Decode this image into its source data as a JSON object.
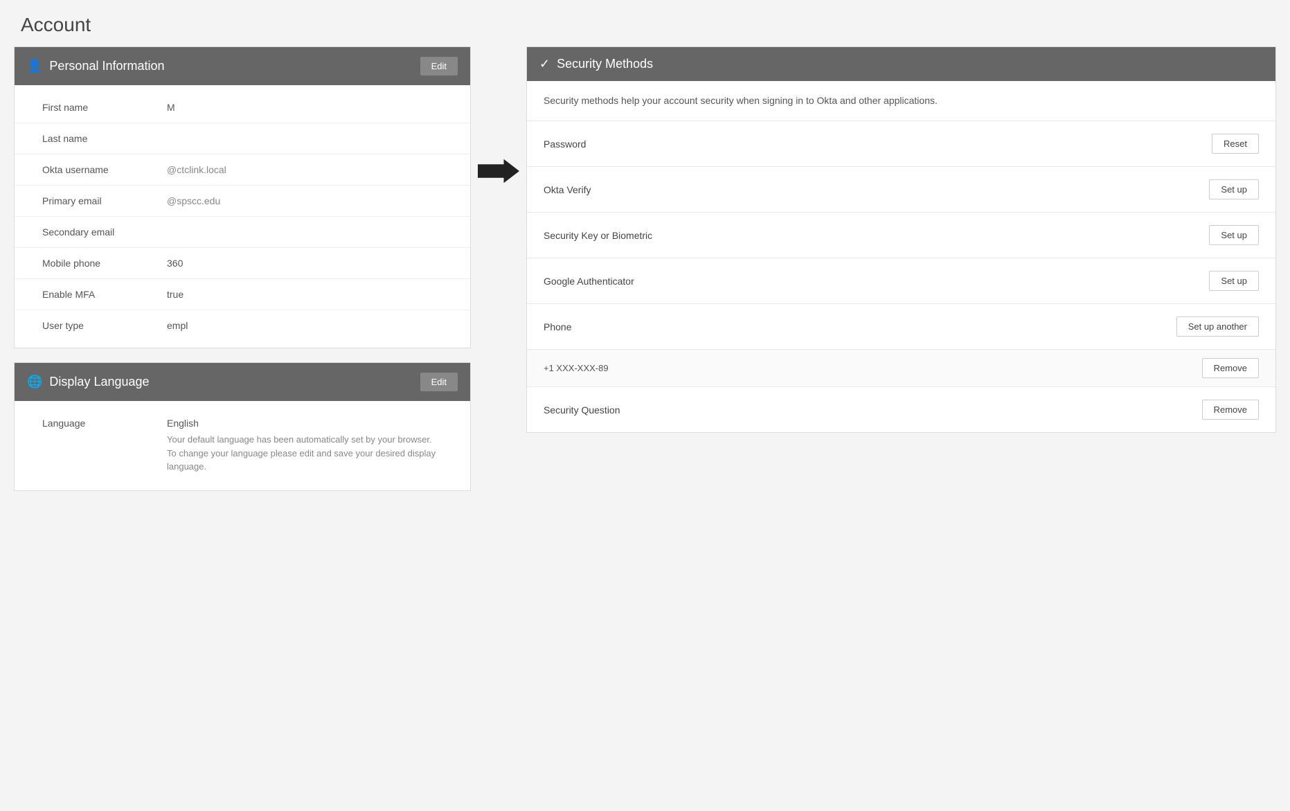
{
  "page": {
    "title": "Account"
  },
  "personal_info": {
    "header_label": "Personal Information",
    "edit_button": "Edit",
    "fields": [
      {
        "label": "First name",
        "value": "M"
      },
      {
        "label": "Last name",
        "value": ""
      },
      {
        "label": "Okta username",
        "value": "@ctclink.local"
      },
      {
        "label": "Primary email",
        "value": "@spscc.edu"
      },
      {
        "label": "Secondary email",
        "value": ""
      },
      {
        "label": "Mobile phone",
        "value": "360"
      },
      {
        "label": "Enable MFA",
        "value": "true"
      },
      {
        "label": "User type",
        "value": "empl"
      }
    ]
  },
  "display_language": {
    "header_label": "Display Language",
    "edit_button": "Edit",
    "fields": [
      {
        "label": "Language",
        "value": "English",
        "note": "Your default language has been automatically set by your browser. To change your language please edit and save your desired display language."
      }
    ]
  },
  "security_methods": {
    "header_label": "Security Methods",
    "description": "Security methods help your account security when signing in to Okta and other applications.",
    "rows": [
      {
        "label": "Password",
        "action": "Reset",
        "sub": null
      },
      {
        "label": "Okta Verify",
        "action": "Set up",
        "sub": null
      },
      {
        "label": "Security Key or Biometric",
        "action": "Set up",
        "sub": null
      },
      {
        "label": "Google Authenticator",
        "action": "Set up",
        "sub": null
      },
      {
        "label": "Phone",
        "action": "Set up another",
        "sub": null
      },
      {
        "phone_entry": "+1 XXX-XXX-89",
        "action": "Remove"
      },
      {
        "label": "Security Question",
        "action": "Remove",
        "sub": null
      }
    ]
  },
  "icons": {
    "person": "👤",
    "globe": "🌐",
    "checkmark": "✓",
    "arrow_right": "➔"
  }
}
